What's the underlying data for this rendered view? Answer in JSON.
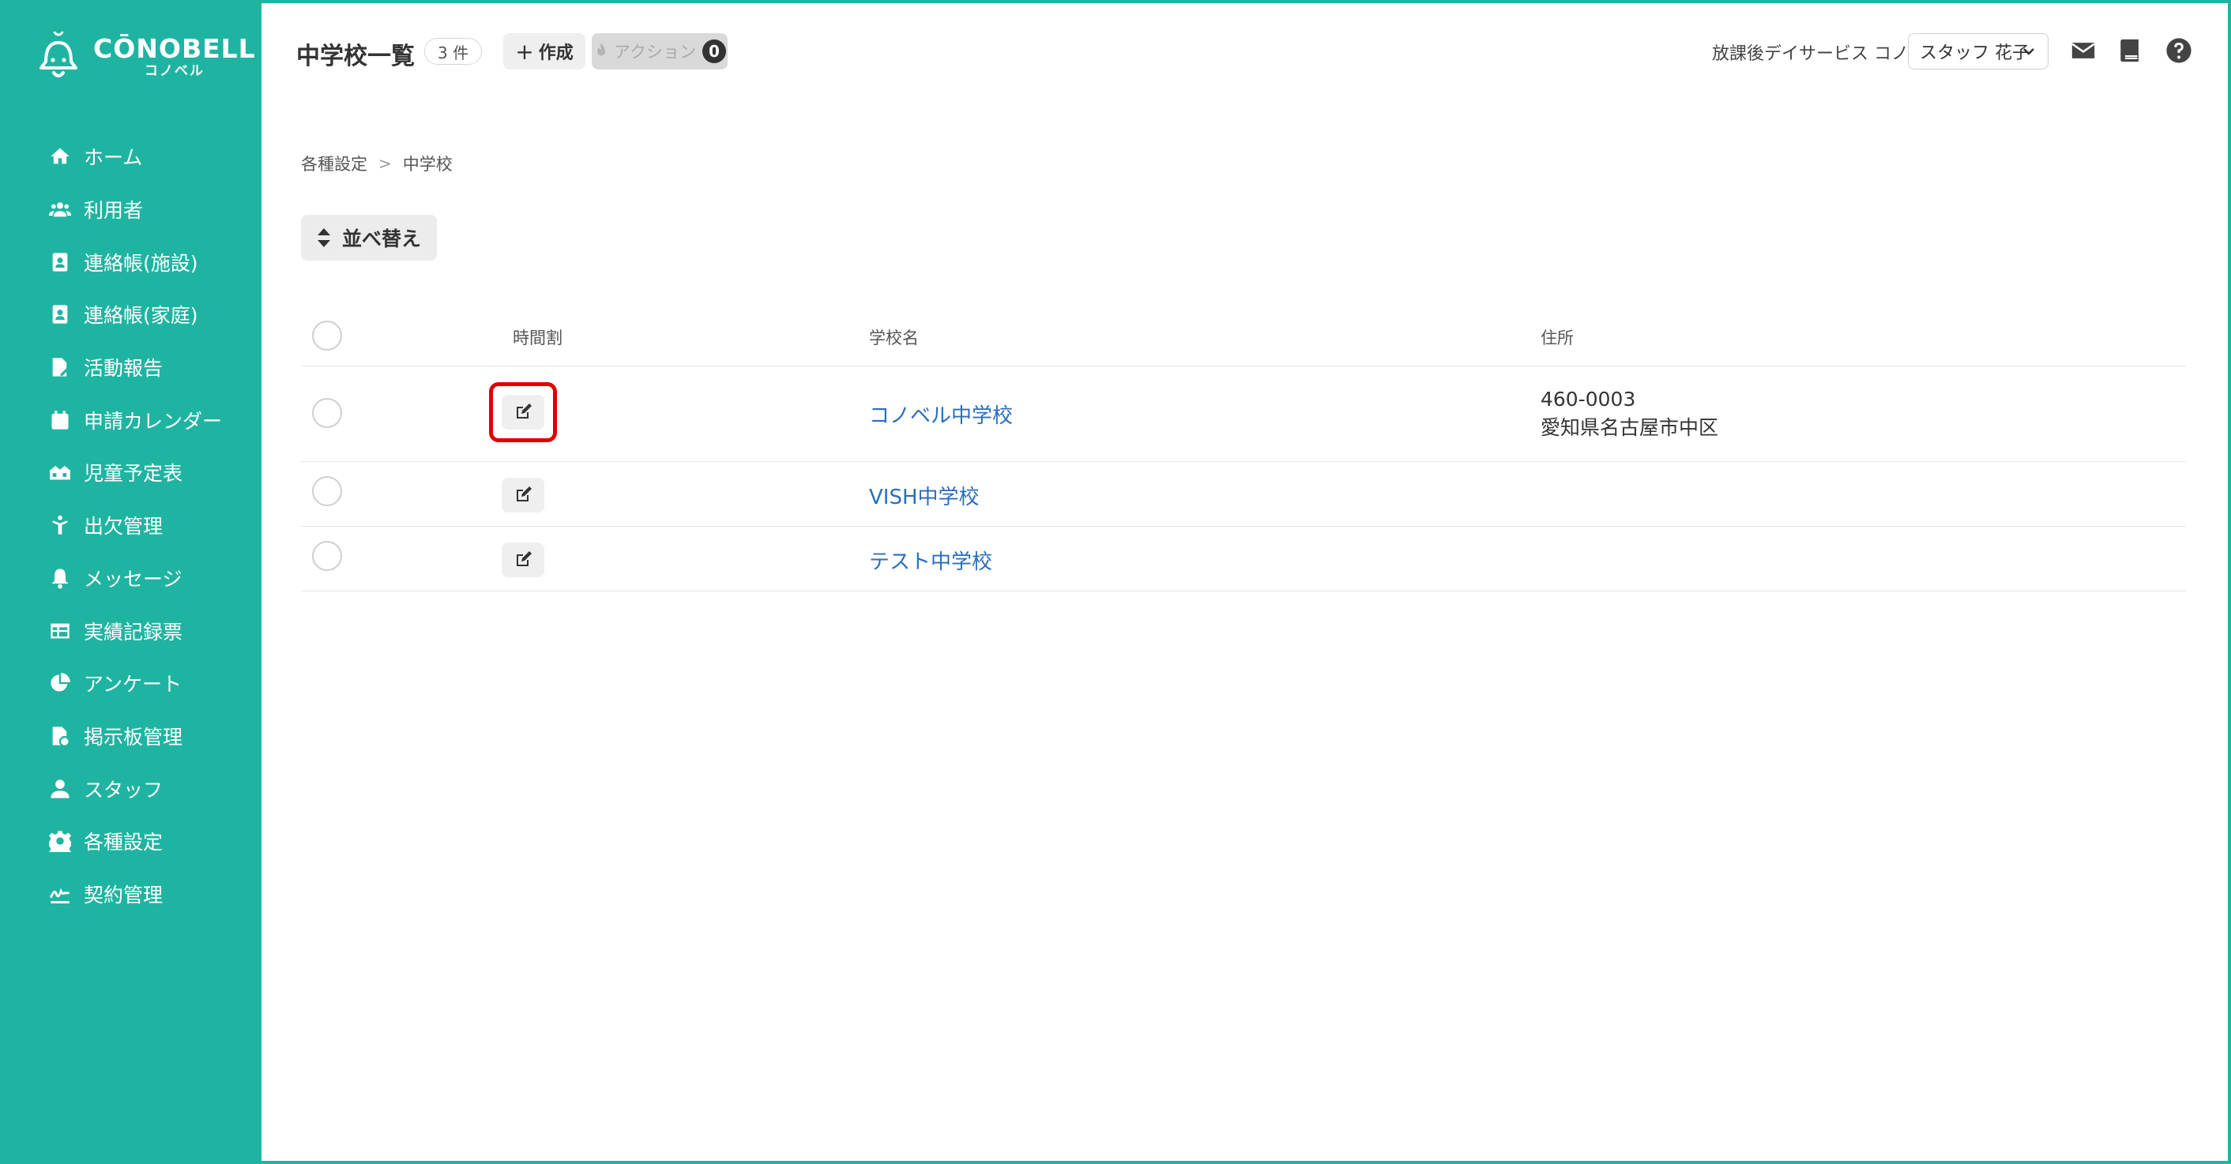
{
  "colors": {
    "sidebar": "#1fb4a2",
    "link": "#2a6ebd",
    "highlight": "#e00000"
  },
  "logo": {
    "main": "CŌNOBELL",
    "sub": "コノベル"
  },
  "sidebar": {
    "items": [
      {
        "label": "ホーム",
        "icon": "home-icon"
      },
      {
        "label": "利用者",
        "icon": "users-icon"
      },
      {
        "label": "連絡帳(施設)",
        "icon": "contact-book-icon"
      },
      {
        "label": "連絡帳(家庭)",
        "icon": "contact-book-icon"
      },
      {
        "label": "活動報告",
        "icon": "report-icon"
      },
      {
        "label": "申請カレンダー",
        "icon": "calendar-icon"
      },
      {
        "label": "児童予定表",
        "icon": "schedule-icon"
      },
      {
        "label": "出欠管理",
        "icon": "attendance-icon"
      },
      {
        "label": "メッセージ",
        "icon": "bell-icon"
      },
      {
        "label": "実績記録票",
        "icon": "table-icon"
      },
      {
        "label": "アンケート",
        "icon": "pie-chart-icon"
      },
      {
        "label": "掲示板管理",
        "icon": "bulletin-icon"
      },
      {
        "label": "スタッフ",
        "icon": "staff-icon"
      },
      {
        "label": "各種設定",
        "icon": "gear-icon"
      },
      {
        "label": "契約管理",
        "icon": "contract-icon"
      }
    ]
  },
  "header": {
    "title": "中学校一覧",
    "count": "3 件",
    "create_label": "作成",
    "action_label": "アクション",
    "action_count": "0",
    "facility": "放課後デイサービス コノベル",
    "staff": "スタッフ 花子"
  },
  "breadcrumb": {
    "parent": "各種設定",
    "current": "中学校"
  },
  "sort_label": "並べ替え",
  "table": {
    "headers": {
      "timetable": "時間割",
      "school_name": "学校名",
      "address": "住所"
    },
    "rows": [
      {
        "name": "コノベル中学校",
        "postal": "460-0003",
        "address": "愛知県名古屋市中区"
      },
      {
        "name": "VISH中学校",
        "postal": "",
        "address": ""
      },
      {
        "name": "テスト中学校",
        "postal": "",
        "address": ""
      }
    ]
  }
}
